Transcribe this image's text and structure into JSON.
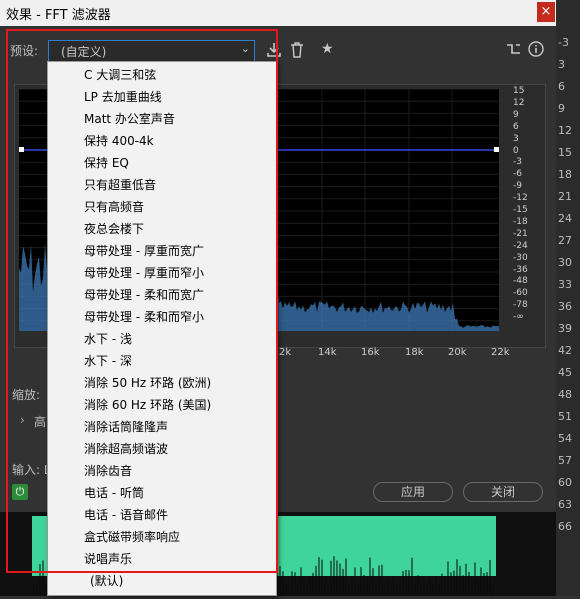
{
  "window": {
    "title": "效果 - FFT 滤波器",
    "close": "×"
  },
  "right_strip_labels": [
    "-3",
    "3",
    "6",
    "9",
    "12",
    "15",
    "18",
    "21",
    "24",
    "27",
    "30",
    "33",
    "36",
    "39",
    "42",
    "45",
    "48",
    "51",
    "54",
    "57",
    "60",
    "63",
    "66"
  ],
  "preset": {
    "label": "预设:",
    "value": "(自定义)",
    "items": [
      "C 大调三和弦",
      "LP 去加重曲线",
      "Matt 办公室声音",
      "保持 400-4k",
      "保持 EQ",
      "只有超重低音",
      "只有高频音",
      "夜总会楼下",
      "母带处理 - 厚重而宽广",
      "母带处理 - 厚重而窄小",
      "母带处理 - 柔和而宽广",
      "母带处理 - 柔和而窄小",
      "水下 - 浅",
      "水下 - 深",
      "消除 50 Hz 环路 (欧洲)",
      "消除 60 Hz 环路 (美国)",
      "消除话筒隆隆声",
      "消除超高频谐波",
      "消除齿音",
      "电话 - 听筒",
      "电话 - 语音邮件",
      "盒式磁带频率响应",
      "说唱声乐",
      "(默认)"
    ]
  },
  "graph": {
    "db_labels": [
      "15",
      "12",
      "9",
      "6",
      "3",
      "0",
      "-3",
      "-6",
      "-9",
      "-12",
      "-15",
      "-18",
      "-21",
      "-24",
      "-30",
      "-36",
      "-48",
      "-60",
      "-78",
      "-∞"
    ],
    "freq_labels": [
      "2k",
      "14k",
      "16k",
      "18k",
      "20k",
      "22k"
    ],
    "curve_color": "#3a46e6",
    "spectrum_color": "#3d7ab8"
  },
  "lower": {
    "zoom_label": "缩放:",
    "advanced_label": "高",
    "input_label": "输入: L",
    "apply_button": "应用",
    "close_button": "关闭"
  },
  "colors": {
    "highlight_box": "#e1191d",
    "waveform": "#3fd49a"
  }
}
